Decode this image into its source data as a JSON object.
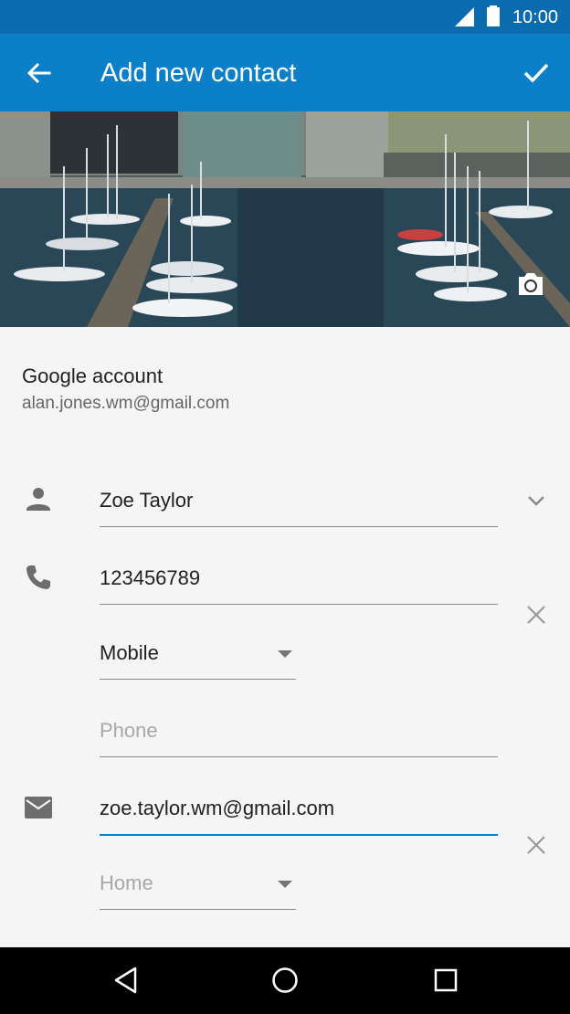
{
  "status_bar": {
    "time": "10:00"
  },
  "app_bar": {
    "title": "Add new contact"
  },
  "account": {
    "label": "Google account",
    "email": "alan.jones.wm@gmail.com"
  },
  "form": {
    "name": {
      "value": "Zoe Taylor"
    },
    "phone": {
      "value": "123456789",
      "type": "Mobile"
    },
    "phone_new": {
      "placeholder": "Phone"
    },
    "email": {
      "value": "zoe.taylor.wm@gmail.com",
      "type_placeholder": "Home"
    }
  },
  "colors": {
    "status_bar": "#0a6cae",
    "app_bar": "#0b7fc7",
    "accent": "#0b7fc7",
    "background": "#f5f5f5"
  },
  "icons": [
    "back-arrow-icon",
    "check-icon",
    "camera-icon",
    "person-icon",
    "expand-icon",
    "phone-icon",
    "clear-icon",
    "email-icon",
    "back-nav-icon",
    "home-nav-icon",
    "recents-nav-icon"
  ]
}
